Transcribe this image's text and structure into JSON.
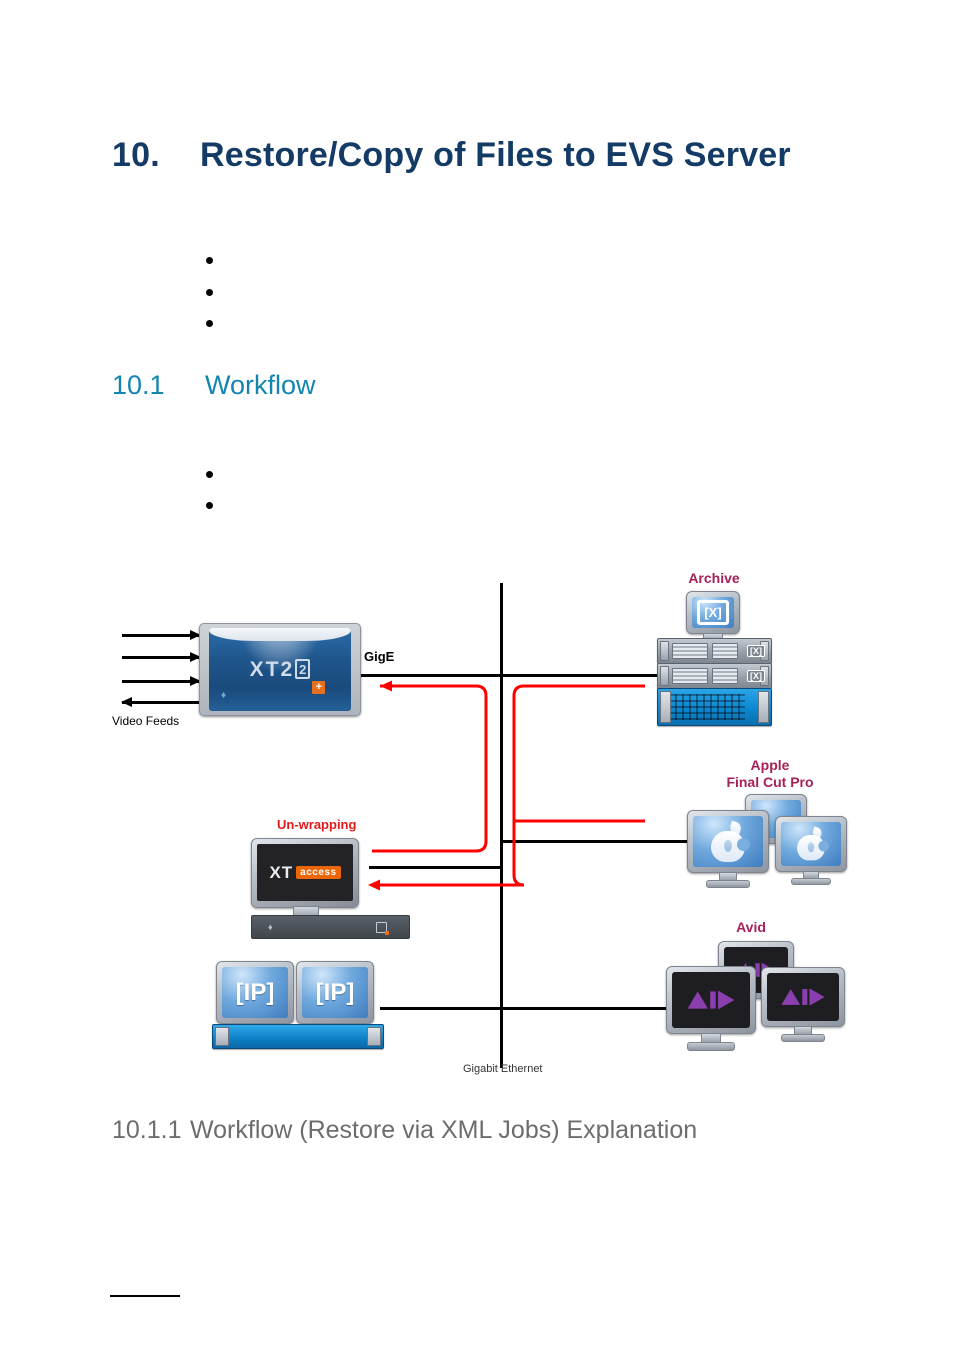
{
  "document": {
    "chapter_number": "10.",
    "chapter_title": "Restore/Copy of Files to EVS Server",
    "section_number": "10.1",
    "section_title": "Workflow",
    "subsection_number": "10.1.1",
    "subsection_title": "Workflow (Restore via XML Jobs) Explanation",
    "colors": {
      "chapter_heading": "#143a66",
      "section_heading": "#1385b0",
      "subsection_heading": "#6d6d6d",
      "device_label": "#a62158",
      "process_label": "#e01b1b",
      "data_path": "#ff0000",
      "network_line": "#000000"
    }
  },
  "bullet_lists": {
    "intro_bullets": [
      "",
      "",
      ""
    ],
    "workflow_bullets": [
      "",
      ""
    ]
  },
  "diagram": {
    "name": "Restore via XML Jobs workflow",
    "network_label": "Gigabit Ethernet",
    "link_label": "GigE",
    "nodes": {
      "xt2_server": {
        "label": "XT2",
        "superscript": "+",
        "exponent": "2",
        "feeds_label": "Video Feeds",
        "feed_in_count": 3,
        "feed_out_count": 1
      },
      "archive": {
        "label": "Archive",
        "monitor_glyph": "[X]",
        "tape_units": [
          "[X]",
          "[X]"
        ],
        "storage_array": "blue-disk-array"
      },
      "apple": {
        "label_line1": "Apple",
        "label_line2": "Final Cut Pro",
        "monitor_count": 3,
        "glyph": "apple-logo"
      },
      "avid": {
        "label": "Avid",
        "monitor_count": 3,
        "glyph": "avid-logo"
      },
      "xt_access": {
        "label": "Un-wrapping",
        "brand_main": "XT",
        "brand_badge": "access"
      },
      "ip_servers": {
        "glyph": "[IP]",
        "monitor_count": 2
      }
    }
  }
}
